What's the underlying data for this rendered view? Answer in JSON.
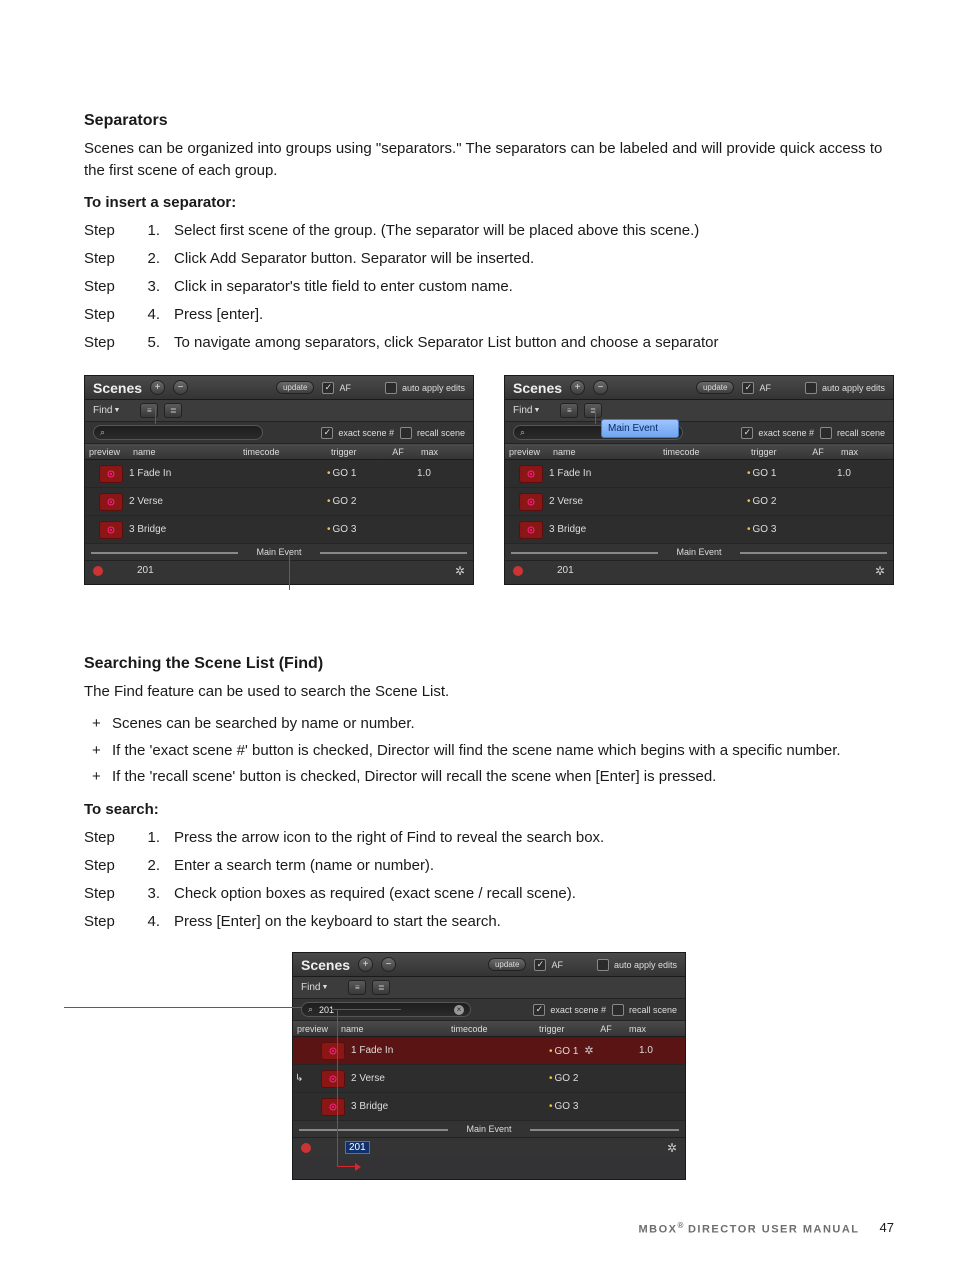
{
  "headings": {
    "separators": "Separators",
    "searching": "Searching the Scene List (Find)"
  },
  "separators_intro": "Scenes can be organized into groups using \"separators.\" The separators can be labeled and will provide quick access to the first scene of each group.",
  "insert_label": "To insert a separator:",
  "step_label": "Step",
  "insert_steps": [
    "Select first scene of the group. (The separator will be placed above this scene.)",
    "Click Add Separator button. Separator will be inserted.",
    "Click in separator's title field to enter custom name.",
    "Press [enter].",
    "To navigate among separators, click Separator List button and choose a separator"
  ],
  "find_intro": "The Find feature can be used to search the Scene List.",
  "find_bullets": [
    "Scenes can be searched by name or number.",
    "If the 'exact scene #' button is checked, Director will find the scene name which begins with a specific number.",
    "If the 'recall scene' button is checked, Director will recall the scene when [Enter] is pressed."
  ],
  "search_label": "To search:",
  "search_steps": [
    "Press the arrow icon to the right of Find to reveal the search box.",
    "Enter a search term (name or number).",
    "Check option boxes as required (exact scene / recall scene).",
    "Press [Enter] on the keyboard to start the search."
  ],
  "ui": {
    "title": "Scenes",
    "update": "update",
    "af": "AF",
    "auto_apply": "auto apply edits",
    "find": "Find",
    "exact": "exact scene #",
    "recall": "recall scene",
    "cols": {
      "preview": "preview",
      "name": "name",
      "timecode": "timecode",
      "trigger": "trigger",
      "af": "AF",
      "max": "max"
    },
    "rows": [
      {
        "name": "1 Fade In",
        "trigger": "GO 1",
        "max": "1.0"
      },
      {
        "name": "2 Verse",
        "trigger": "GO 2",
        "max": ""
      },
      {
        "name": "3 Bridge",
        "trigger": "GO 3",
        "max": ""
      }
    ],
    "separator": "Main Event",
    "footer_text": "201",
    "dropdown": "Main Event",
    "search_value": "201"
  },
  "footer": {
    "product": "MBOX",
    "reg": "®",
    "suffix": " DIRECTOR USER MANUAL",
    "page": "47"
  }
}
